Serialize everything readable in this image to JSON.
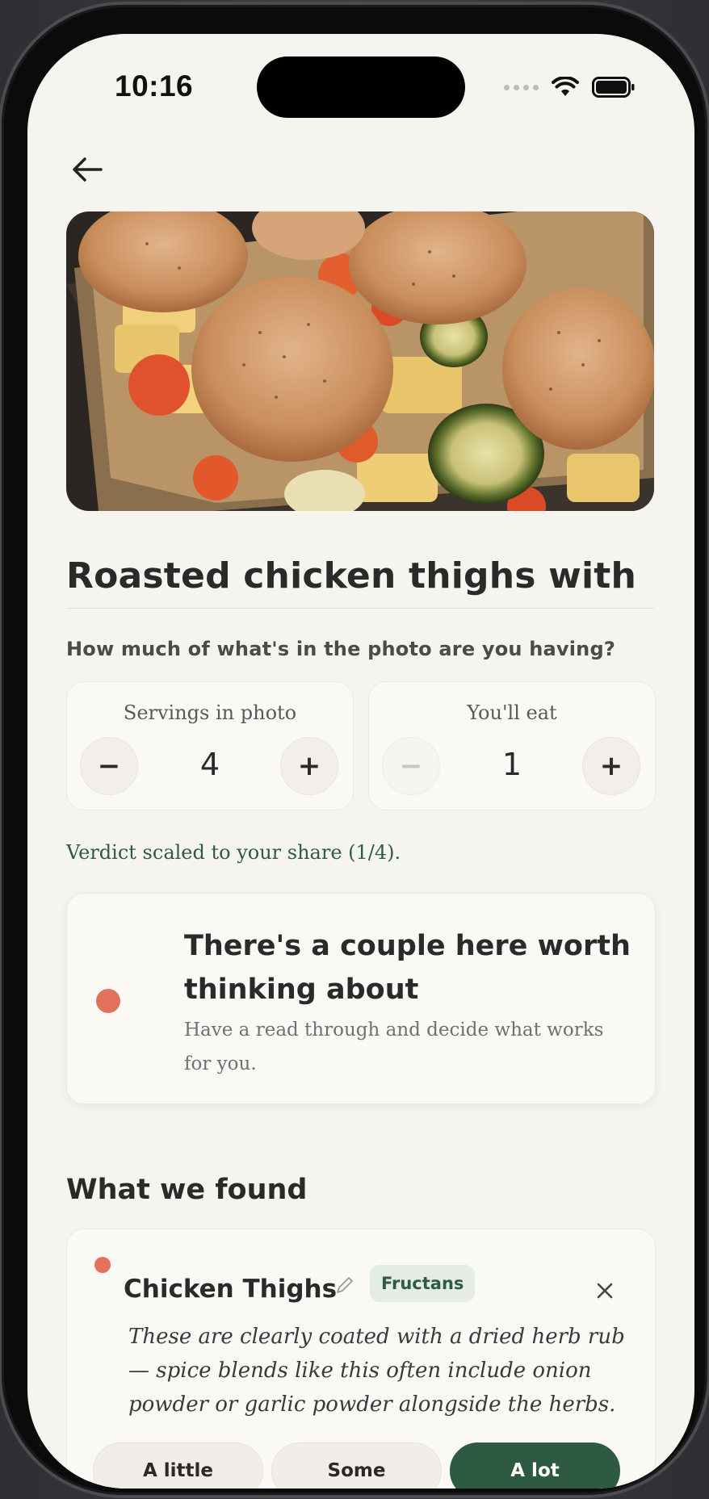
{
  "status_bar": {
    "time": "10:16"
  },
  "recipe": {
    "title": "Roasted chicken thighs with"
  },
  "portion": {
    "question": "How much of what's in the photo are you having?",
    "servings_in_photo": {
      "label": "Servings in photo",
      "value": "4",
      "minus": "−",
      "plus": "+"
    },
    "you_eat": {
      "label": "You'll eat",
      "value": "1",
      "minus": "−",
      "plus": "+"
    },
    "note": "Verdict scaled to your share (1/4)."
  },
  "verdict": {
    "title": "There's a couple here worth thinking about",
    "subtitle": "Have a read through and decide what works for you.",
    "color": "#e2725b"
  },
  "findings": {
    "section_title": "What we found",
    "items": [
      {
        "name": "Chicken Thighs",
        "tag": "Fructans",
        "dot_color": "#e2725b",
        "description": "These are clearly coated with a dried herb rub — spice blends like this often include onion powder or garlic powder alongside the herbs.",
        "amount_options": [
          "A little",
          "Some",
          "A lot"
        ],
        "selected_amount": "A lot"
      }
    ]
  },
  "colors": {
    "accent": "#2d5a40",
    "warning": "#e2725b",
    "background": "#f6f4ef"
  }
}
